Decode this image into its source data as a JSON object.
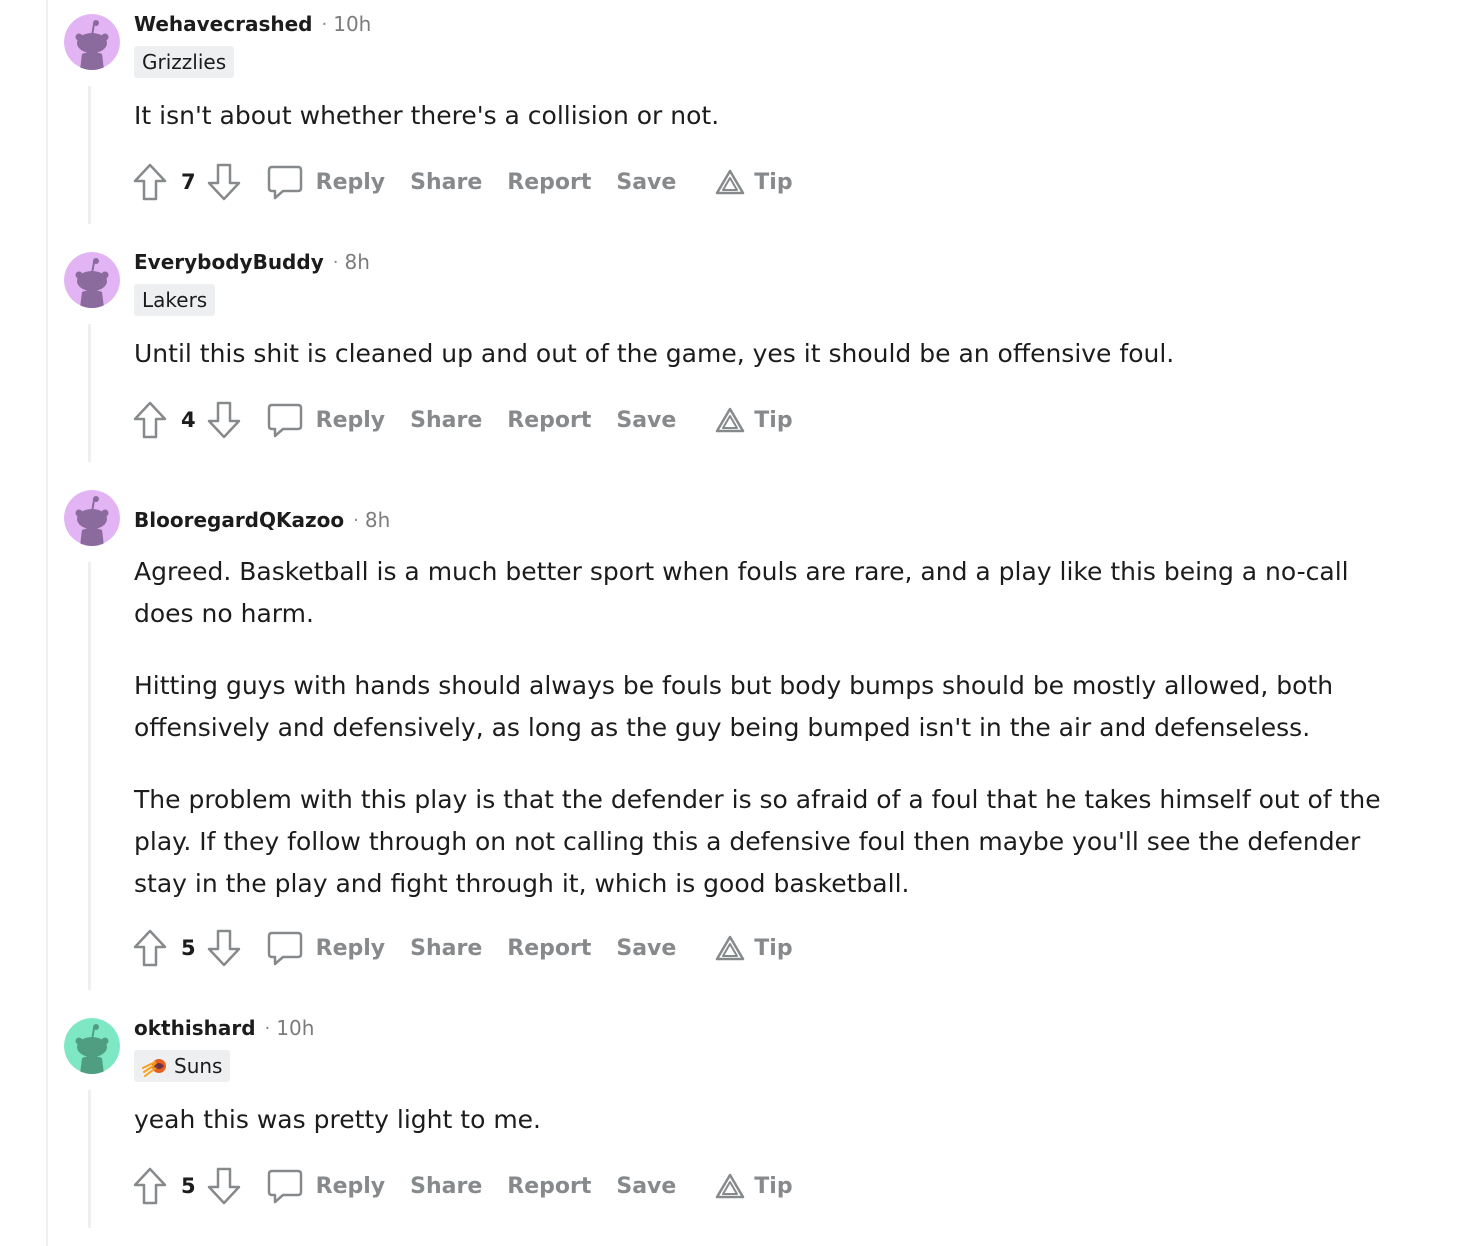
{
  "labels": {
    "reply": "Reply",
    "share": "Share",
    "report": "Report",
    "save": "Save",
    "tip": "Tip"
  },
  "colors": {
    "avatar_purple_bg": "#e3b4f3",
    "avatar_purple_fg": "#8b6a9e",
    "avatar_green_bg": "#7ee8c4",
    "avatar_green_fg": "#4f9e82",
    "action_gray": "#878a8c",
    "flair_bg": "#edeff1"
  },
  "comments": [
    {
      "username": "Wehavecrashed",
      "time": "10h",
      "flair": "Grizzlies",
      "paragraphs": [
        "It isn't about whether there's a collision or not."
      ],
      "score": "7"
    },
    {
      "username": "EverybodyBuddy",
      "time": "8h",
      "flair": "Lakers",
      "paragraphs": [
        "Until this shit is cleaned up and out of the game, yes it should be an offensive foul."
      ],
      "score": "4"
    },
    {
      "username": "BlooregardQKazoo",
      "time": "8h",
      "flair": "",
      "paragraphs": [
        "Agreed. Basketball is a much better sport when fouls are rare, and a play like this being a no-call does no harm.",
        "Hitting guys with hands should always be fouls but body bumps should be mostly allowed, both offensively and defensively, as long as the guy being bumped isn't in the air and defenseless.",
        "The problem with this play is that the defender is so afraid of a foul that he takes himself out of the play. If they follow through on not calling this a defensive foul then maybe you'll see the defender stay in the play and fight through it, which is good basketball."
      ],
      "score": "5"
    },
    {
      "username": "okthishard",
      "time": "10h",
      "flair": "Suns",
      "flair_icon": "suns-logo-icon",
      "paragraphs": [
        "yeah this was pretty light to me."
      ],
      "score": "5"
    }
  ]
}
